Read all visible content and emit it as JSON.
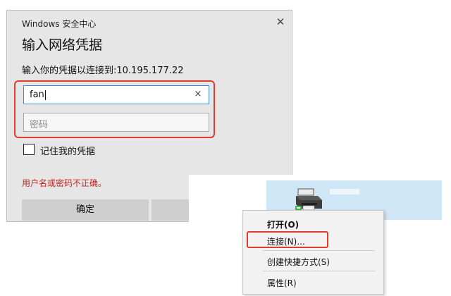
{
  "dialog": {
    "caption": "Windows 安全中心",
    "heading": "输入网络凭据",
    "prompt": "输入你的凭据以连接到:10.195.177.22",
    "username_value": "fan",
    "password_placeholder": "密码",
    "clear_glyph": "×",
    "close_glyph": "✕",
    "remember_label": "记住我的凭据",
    "error_message": "用户名或密码不正确。",
    "ok_label": "确定",
    "cancel_label": ""
  },
  "context_menu": {
    "items": [
      {
        "label": "打开(O)"
      },
      {
        "label": "连接(N)..."
      },
      {
        "label": "创建快捷方式(S)"
      },
      {
        "label": "属性(R)"
      }
    ]
  },
  "colors": {
    "highlight": "#e23b2e",
    "error_text": "#c0261f",
    "dialog_bg": "#e6e6e6",
    "selection_bg": "#cfe6f7"
  },
  "icons": [
    "close-icon",
    "clear-icon",
    "printer-icon"
  ]
}
